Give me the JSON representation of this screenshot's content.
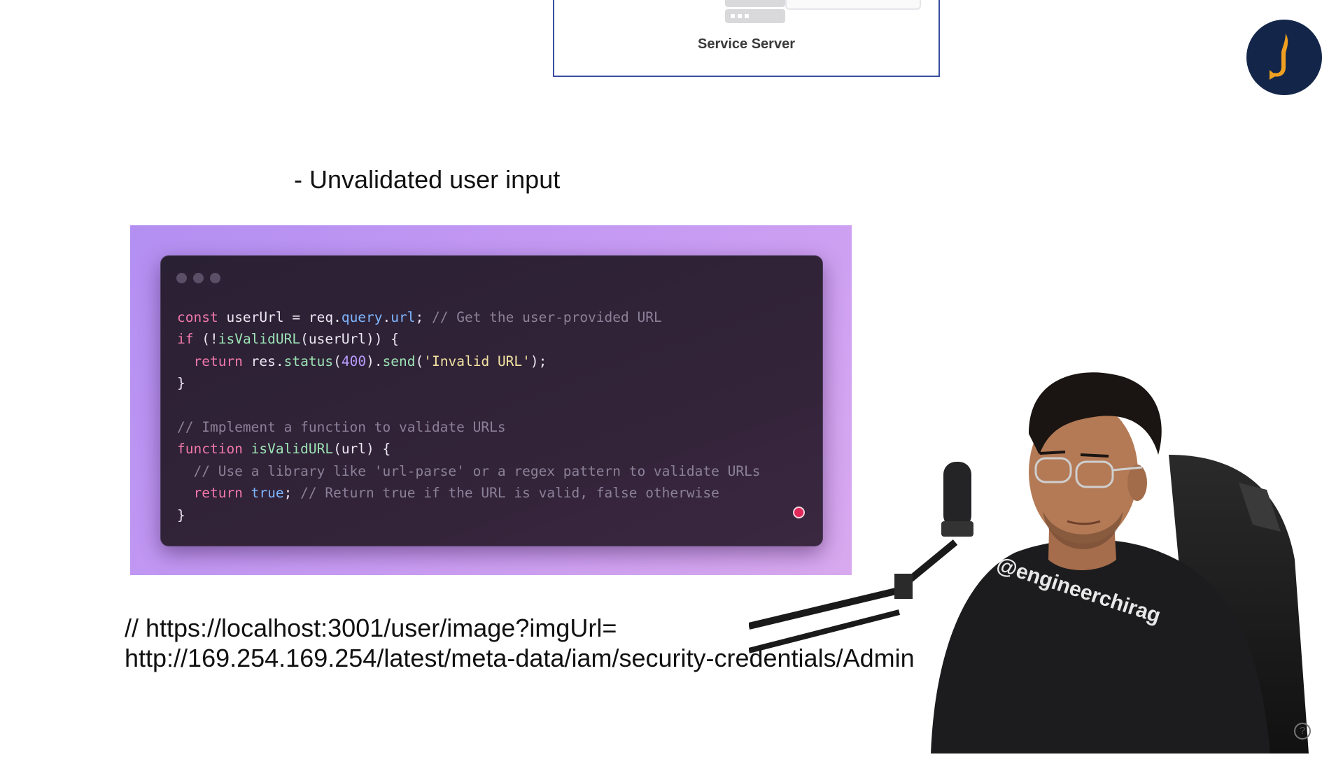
{
  "diagram": {
    "server_label": "Service Server"
  },
  "logo": {
    "icon": "channel-logo-icon"
  },
  "slide": {
    "heading": "- Unvalidated user input",
    "url_lines": [
      "// https://localhost:3001/user/image?imgUrl=",
      "http://169.254.169.254/latest/meta-data/iam/security-credentials/Admin"
    ]
  },
  "code_lines": [
    [
      {
        "t": "kw",
        "v": "const "
      },
      {
        "t": "id",
        "v": "userUrl = req."
      },
      {
        "t": "prop",
        "v": "query"
      },
      {
        "t": "id",
        "v": "."
      },
      {
        "t": "prop",
        "v": "url"
      },
      {
        "t": "id",
        "v": "; "
      },
      {
        "t": "cm",
        "v": "// Get the user-provided URL"
      }
    ],
    [
      {
        "t": "kw",
        "v": "if "
      },
      {
        "t": "id",
        "v": "(!"
      },
      {
        "t": "fn",
        "v": "isValidURL"
      },
      {
        "t": "id",
        "v": "(userUrl)) {"
      }
    ],
    [
      {
        "t": "id",
        "v": "  "
      },
      {
        "t": "kw",
        "v": "return "
      },
      {
        "t": "id",
        "v": "res."
      },
      {
        "t": "fn",
        "v": "status"
      },
      {
        "t": "id",
        "v": "("
      },
      {
        "t": "num",
        "v": "400"
      },
      {
        "t": "id",
        "v": ")."
      },
      {
        "t": "fn",
        "v": "send"
      },
      {
        "t": "id",
        "v": "("
      },
      {
        "t": "str",
        "v": "'Invalid URL'"
      },
      {
        "t": "id",
        "v": ");"
      }
    ],
    [
      {
        "t": "id",
        "v": "}"
      }
    ],
    [
      {
        "t": "id",
        "v": ""
      }
    ],
    [
      {
        "t": "cm",
        "v": "// Implement a function to validate URLs"
      }
    ],
    [
      {
        "t": "kw",
        "v": "function "
      },
      {
        "t": "fn",
        "v": "isValidURL"
      },
      {
        "t": "id",
        "v": "(url) {"
      }
    ],
    [
      {
        "t": "id",
        "v": "  "
      },
      {
        "t": "cm",
        "v": "// Use a library like 'url-parse' or a regex pattern to validate URLs"
      }
    ],
    [
      {
        "t": "id",
        "v": "  "
      },
      {
        "t": "kw",
        "v": "return "
      },
      {
        "t": "bool",
        "v": "true"
      },
      {
        "t": "id",
        "v": "; "
      },
      {
        "t": "cm",
        "v": "// Return true if the URL is valid, false otherwise"
      }
    ],
    [
      {
        "t": "id",
        "v": "}"
      }
    ]
  ],
  "presenter": {
    "shirt_text": "@engineerchirag"
  },
  "help": {
    "icon": "help-icon",
    "label": "?"
  },
  "colors": {
    "panel_gradient_start": "#b38ff2",
    "panel_gradient_end": "#d9a9ef",
    "code_bg": "#2a2034",
    "keyword": "#f178a9",
    "function": "#9ce3b4",
    "property": "#7fb6ff",
    "string": "#f3e3a2",
    "comment": "#8b8199",
    "logo_bg": "#13264a",
    "logo_flame": "#f0a020"
  }
}
